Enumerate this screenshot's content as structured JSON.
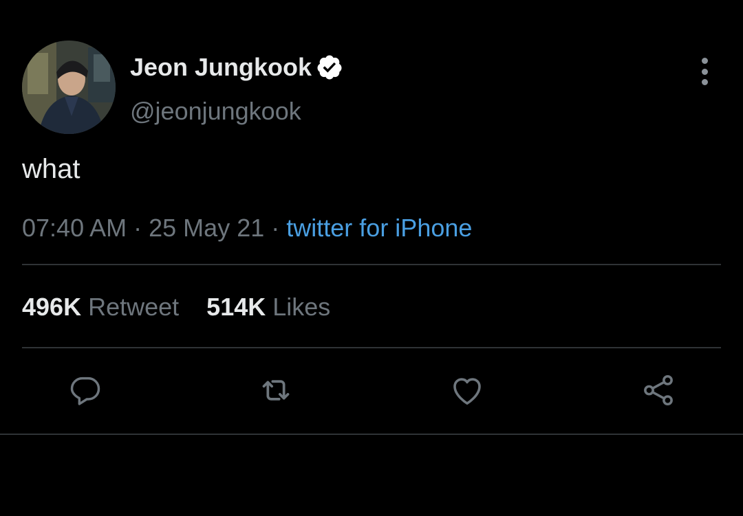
{
  "tweet": {
    "author": {
      "display_name": "Jeon Jungkook",
      "handle": "@jeonjungkook",
      "verified": true
    },
    "text": "what",
    "meta": {
      "time": "07:40 AM",
      "separator": "·",
      "date": "25 May 21",
      "source": "twitter for iPhone"
    },
    "stats": {
      "retweets_count": "496K",
      "retweets_label": "Retweet",
      "likes_count": "514K",
      "likes_label": "Likes"
    }
  },
  "actions": [
    {
      "name": "reply",
      "icon": "reply-icon"
    },
    {
      "name": "retweet",
      "icon": "retweet-icon"
    },
    {
      "name": "like",
      "icon": "heart-icon"
    },
    {
      "name": "share",
      "icon": "share-icon"
    }
  ],
  "colors": {
    "background": "#000000",
    "text_primary": "#e7e9ea",
    "text_secondary": "#6e767d",
    "link": "#4a9fe2",
    "divider": "#2f3336"
  }
}
